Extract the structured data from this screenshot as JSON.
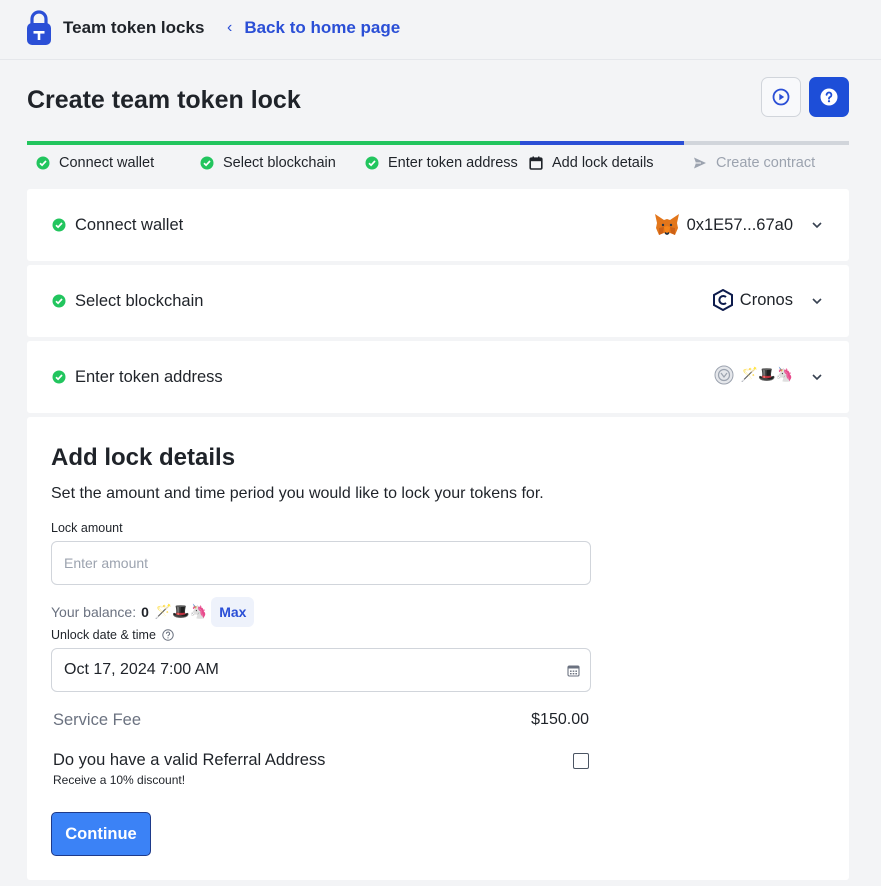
{
  "header": {
    "app_title": "Team token locks",
    "back_link": "Back to home page"
  },
  "page": {
    "title": "Create team token lock"
  },
  "steps": [
    {
      "label": "Connect wallet",
      "status": "done"
    },
    {
      "label": "Select blockchain",
      "status": "done"
    },
    {
      "label": "Enter token address",
      "status": "done"
    },
    {
      "label": "Add lock details",
      "status": "current"
    },
    {
      "label": "Create contract",
      "status": "future"
    }
  ],
  "progress": {
    "fraction_complete": 0.6,
    "fraction_current": 0.2
  },
  "cards": {
    "wallet": {
      "label": "Connect wallet",
      "value": "0x1E57...67a0",
      "icon": "metamask-fox-icon"
    },
    "blockchain": {
      "label": "Select blockchain",
      "value": "Cronos",
      "icon": "cronos-icon"
    },
    "token": {
      "label": "Enter token address",
      "icon": "token-logo-icon",
      "symbol": "🪄🎩🦄"
    }
  },
  "details": {
    "title": "Add lock details",
    "subtitle": "Set the amount and time period you would like to lock your tokens for.",
    "lock_amount_label": "Lock amount",
    "lock_amount_placeholder": "Enter amount",
    "lock_amount_value": "",
    "balance_label": "Your balance:",
    "balance_value": "0",
    "balance_symbol": "🪄🎩🦄",
    "max_label": "Max",
    "unlock_label": "Unlock date & time",
    "unlock_value": "Oct 17, 2024 7:00 AM",
    "fee_label": "Service Fee",
    "fee_value": "$150.00",
    "referral_label": "Do you have a valid Referral Address",
    "referral_sub": "Receive a 10% discount!",
    "continue_label": "Continue"
  },
  "colors": {
    "accent": "#2b4fd6",
    "success": "#22c55e",
    "button": "#3b82f6",
    "help_button": "#1d4ed8"
  }
}
